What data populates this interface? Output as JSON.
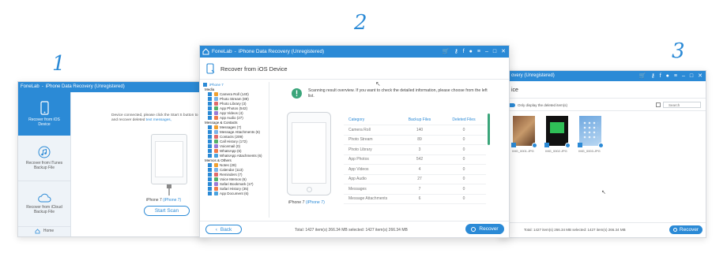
{
  "steps": {
    "s1": "1",
    "s2": "2",
    "s3": "3"
  },
  "app_name": "FoneLab",
  "title_suffix": "iPhone Data Recovery (Unregistered)",
  "title_partial": "overy (Unregistered)",
  "w1": {
    "sidebar": [
      {
        "label": "Recover from iOS Device"
      },
      {
        "label": "Recover from iTunes Backup File"
      },
      {
        "label": "Recover from iCloud Backup File"
      }
    ],
    "home": "Home",
    "msg": "Device connected, please click the Start S button to scan and recover deleted",
    "msg_link": "text messages,",
    "device": "iPhone 7",
    "device_model": "(iPhone 7)",
    "start_scan": "Start Scan"
  },
  "w2": {
    "header": "Recover from iOS Device",
    "tree": {
      "device": "iPhone 7",
      "media": "Media",
      "media_items": [
        "Camera Roll (140)",
        "Photo Stream (89)",
        "Photo Library (3)",
        "App Photos (542)",
        "App Videos (4)",
        "App Audio (27)"
      ],
      "msg_contacts": "Message & Contacts",
      "msg_items": [
        "Messages (7)",
        "Message Attachments (6)",
        "Contacts (209)",
        "Call History (172)",
        "Voicemail (0)",
        "WhatsApp (6)",
        "WhatsApp Attachments (6)"
      ],
      "memos": "Memos & Others",
      "memo_items": [
        "Notes (28)",
        "Calendar (113)",
        "Reminders (7)",
        "Voice Memos (6)",
        "Safari Bookmark (17)",
        "Safari History (35)",
        "App Document (6)"
      ]
    },
    "info": "Scanning result overview. If you want to check the detailed information, please choose from the left list.",
    "device": "iPhone 7",
    "device_model": "(iPhone 7)",
    "table": {
      "headers": [
        "Category",
        "Backup Files",
        "Deleted Files"
      ],
      "rows": [
        [
          "Camera Roll",
          "140",
          "0"
        ],
        [
          "Photo Stream",
          "89",
          "0"
        ],
        [
          "Photo Library",
          "3",
          "0"
        ],
        [
          "App Photos",
          "542",
          "0"
        ],
        [
          "App Videos",
          "4",
          "0"
        ],
        [
          "App Audio",
          "27",
          "0"
        ],
        [
          "Messages",
          "7",
          "0"
        ],
        [
          "Message Attachments",
          "6",
          "0"
        ]
      ]
    },
    "back": "Back",
    "status": "Total: 1427 item(s) 266.34 MB   selected: 1427 item(s) 266.34 MB",
    "recover": "Recover"
  },
  "w3": {
    "header_partial": "ice",
    "only_deleted": "Only display the deleted item(s)",
    "search_placeholder": "Search",
    "thumbs": [
      "IMG_0001.JPG",
      "IMG_0002.JPG",
      "IMG_0003.JPG"
    ],
    "status": "Total: 1427 item(s) 266.34 MB   selected: 1427 item(s) 266.34 MB",
    "recover": "Recover"
  },
  "colors": {
    "accent": "#2b8ad6",
    "green": "#3aa57a",
    "sidebar_bg": "#eef3f8"
  }
}
